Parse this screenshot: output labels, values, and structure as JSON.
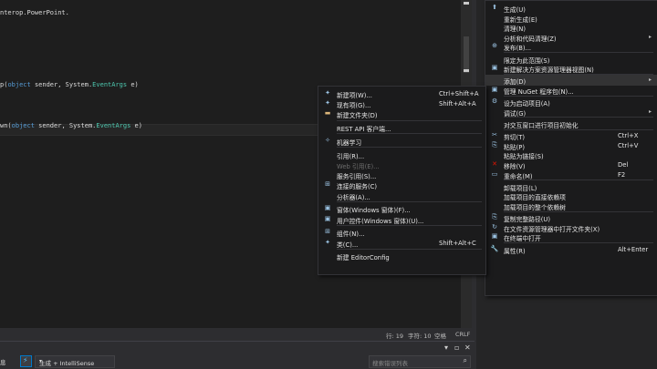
{
  "editor": {
    "lines": [
      {
        "segs": [
          {
            "t": "nterop.PowerPoint.",
            "c": "c-text"
          }
        ]
      },
      {
        "segs": [
          {
            "t": "p(",
            "c": "c-text"
          },
          {
            "t": "object",
            "c": "c-kw"
          },
          {
            "t": " sender, System.",
            "c": "c-text"
          },
          {
            "t": "EventArgs",
            "c": "c-type"
          },
          {
            "t": " e)",
            "c": "c-text"
          }
        ]
      },
      {
        "segs": [
          {
            "t": "wn(",
            "c": "c-text"
          },
          {
            "t": "object",
            "c": "c-kw"
          },
          {
            "t": " sender, System.",
            "c": "c-text"
          },
          {
            "t": "EventArgs",
            "c": "c-type"
          },
          {
            "t": " e)",
            "c": "c-text"
          }
        ]
      }
    ]
  },
  "status": {
    "line": "行: 19",
    "char": "字符: 10",
    "space": "空格",
    "eol": "CRLF"
  },
  "output": {
    "prefix": "息",
    "build_dropdown": "生成 + IntelliSense",
    "search_placeholder": "搜索错误列表",
    "search_icon": "search-icon"
  },
  "menu_main": {
    "items": [
      {
        "type": "item",
        "icon": "⬆",
        "label": "生成(U)"
      },
      {
        "type": "item",
        "icon": "",
        "label": "重新生成(E)"
      },
      {
        "type": "item",
        "icon": "",
        "label": "清理(N)"
      },
      {
        "type": "item",
        "icon": "",
        "label": "分析和代码清理(Z)",
        "sub": true
      },
      {
        "type": "item",
        "icon": "⊕",
        "label": "发布(B)..."
      },
      {
        "type": "sep"
      },
      {
        "type": "item",
        "icon": "",
        "label": "限定为此范围(S)"
      },
      {
        "type": "item",
        "icon": "▣",
        "label": "新建解决方案资源管理器视图(N)"
      },
      {
        "type": "sep"
      },
      {
        "type": "item",
        "icon": "",
        "label": "添加(D)",
        "sub": true,
        "selected": true
      },
      {
        "type": "item",
        "icon": "▣",
        "label": "管理 NuGet 程序包(N)..."
      },
      {
        "type": "sep"
      },
      {
        "type": "item",
        "icon": "⚙",
        "label": "设为启动项目(A)"
      },
      {
        "type": "item",
        "icon": "",
        "label": "调试(G)",
        "sub": true
      },
      {
        "type": "sep"
      },
      {
        "type": "item",
        "icon": "",
        "label": "对交互窗口进行项目初始化"
      },
      {
        "type": "sep"
      },
      {
        "type": "item",
        "icon": "✂",
        "label": "剪切(T)",
        "shortcut": "Ctrl+X"
      },
      {
        "type": "item",
        "icon": "⎘",
        "label": "粘贴(P)",
        "shortcut": "Ctrl+V"
      },
      {
        "type": "item",
        "icon": "",
        "label": "粘贴为链接(S)"
      },
      {
        "type": "item",
        "icon": "✕",
        "label": "移除(V)",
        "shortcut": "Del",
        "color": "#e51400"
      },
      {
        "type": "item",
        "icon": "▭",
        "label": "重命名(M)",
        "shortcut": "F2"
      },
      {
        "type": "sep"
      },
      {
        "type": "item",
        "icon": "",
        "label": "卸载项目(L)"
      },
      {
        "type": "item",
        "icon": "",
        "label": "加载项目的直接依赖项"
      },
      {
        "type": "item",
        "icon": "",
        "label": "加载项目的整个依赖树"
      },
      {
        "type": "sep"
      },
      {
        "type": "item",
        "icon": "⎘",
        "label": "复制完整路径(U)"
      },
      {
        "type": "item",
        "icon": "↻",
        "label": "在文件资源管理器中打开文件夹(X)"
      },
      {
        "type": "item",
        "icon": "▣",
        "label": "在终端中打开"
      },
      {
        "type": "sep"
      },
      {
        "type": "item",
        "icon": "🔧",
        "label": "属性(R)",
        "shortcut": "Alt+Enter"
      }
    ]
  },
  "menu_add": {
    "items": [
      {
        "type": "item",
        "icon": "✦",
        "label": "新建项(W)...",
        "shortcut": "Ctrl+Shift+A"
      },
      {
        "type": "item",
        "icon": "✦",
        "label": "现有项(G)...",
        "shortcut": "Shift+Alt+A"
      },
      {
        "type": "item",
        "icon": "▬",
        "label": "新建文件夹(D)",
        "color": "#dcb67a"
      },
      {
        "type": "sep"
      },
      {
        "type": "item",
        "icon": "",
        "label": "REST API 客户端..."
      },
      {
        "type": "sep"
      },
      {
        "type": "item",
        "icon": "✧",
        "label": "机器学习"
      },
      {
        "type": "sep"
      },
      {
        "type": "item",
        "icon": "",
        "label": "引用(R)..."
      },
      {
        "type": "item",
        "icon": "",
        "label": "Web 引用(E)...",
        "disabled": true
      },
      {
        "type": "item",
        "icon": "",
        "label": "服务引用(S)..."
      },
      {
        "type": "item",
        "icon": "⊞",
        "label": "连接的服务(C)"
      },
      {
        "type": "item",
        "icon": "",
        "label": "分析器(A)..."
      },
      {
        "type": "sep"
      },
      {
        "type": "item",
        "icon": "▣",
        "label": "窗体(Windows 窗体)(F)..."
      },
      {
        "type": "item",
        "icon": "▣",
        "label": "用户控件(Windows 窗体)(U)..."
      },
      {
        "type": "sep"
      },
      {
        "type": "item",
        "icon": "⊞",
        "label": "组件(N)..."
      },
      {
        "type": "item",
        "icon": "✦",
        "label": "类(C)...",
        "shortcut": "Shift+Alt+C"
      },
      {
        "type": "sep"
      },
      {
        "type": "item",
        "icon": "",
        "label": "新建 EditorConfig"
      }
    ]
  }
}
